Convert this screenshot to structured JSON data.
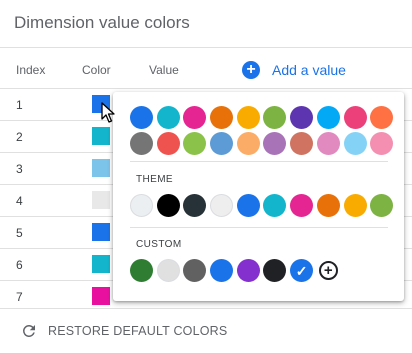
{
  "panel": {
    "title": "Dimension value colors"
  },
  "table": {
    "headers": {
      "index": "Index",
      "color": "Color",
      "value": "Value"
    },
    "add_value_label": "Add a value",
    "rows": [
      {
        "index": "1",
        "color": "#1a73e8"
      },
      {
        "index": "2",
        "color": "#12b5cb"
      },
      {
        "index": "3",
        "color": "#7cc4ea"
      },
      {
        "index": "4",
        "color": "#e8e8e8"
      },
      {
        "index": "5",
        "color": "#1a73e8"
      },
      {
        "index": "6",
        "color": "#12b5cb"
      },
      {
        "index": "7",
        "color": "#e8119f"
      }
    ]
  },
  "palette": {
    "default_row1": [
      "#1a73e8",
      "#12b5cb",
      "#e52592",
      "#e8710a",
      "#f9ab00",
      "#7cb342",
      "#5e35b1",
      "#03a9f4",
      "#ec407a",
      "#ff7043"
    ],
    "default_row2": [
      "#757575",
      "#ef5350",
      "#8bc34a",
      "#5c9bd6",
      "#fbac67",
      "#a973b8",
      "#d07360",
      "#e08ac0",
      "#85d2f7",
      "#f48fb1"
    ],
    "theme_label": "THEME",
    "theme": [
      "#eceff1",
      "#000000",
      "#263238",
      "#eeeeee",
      "#1a73e8",
      "#12b5cb",
      "#e52592",
      "#e8710a",
      "#f9ab00",
      "#7cb342"
    ],
    "custom_label": "CUSTOM",
    "custom": [
      "#2e7d32",
      "#e0e0e0",
      "#616161",
      "#1a73e8",
      "#8430ce",
      "#202124",
      "#1a73e8"
    ],
    "selected_index": 6
  },
  "footer": {
    "restore_label": "RESTORE DEFAULT COLORS"
  },
  "icons": {
    "add": "add-circle-icon",
    "restore": "restore-icon",
    "plus": "plus-circle-icon",
    "check": "check-icon",
    "cursor": "mouse-pointer-icon"
  }
}
